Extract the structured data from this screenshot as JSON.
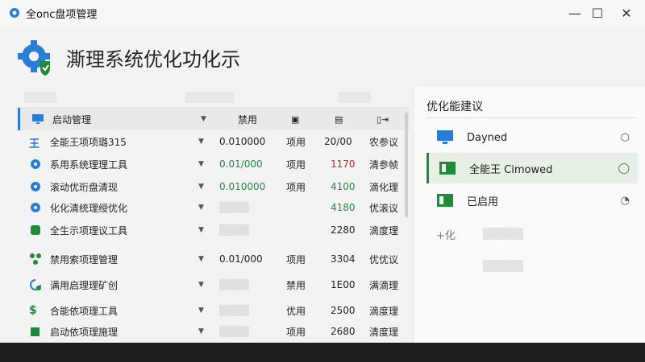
{
  "window": {
    "title": "全onc",
    "title_suffix": "盘项管理",
    "controls": {
      "minimize": "—",
      "maximize": "☐",
      "close": "✕"
    }
  },
  "header": {
    "title": "澌理系统优化功化示"
  },
  "table": {
    "column_headers": {
      "status": "禁用"
    },
    "rows": [
      {
        "name": "启动管理",
        "value": "",
        "c3": "",
        "c4": "",
        "c5": "",
        "icon": "monitor-icon",
        "icon_color": "#2b7cd3",
        "value_color": "#222222",
        "c4_color": "#222222"
      },
      {
        "name": "全能王项项璐315",
        "value": "0.010000",
        "c3": "项用",
        "c4": "20/00",
        "c5": "农参议",
        "icon": "text-icon",
        "icon_color": "#2b7cd3",
        "value_color": "#222222",
        "c4_color": "#222222"
      },
      {
        "name": "系用系统理理工具",
        "value": "0.01/000",
        "c3": "项用",
        "c4": "1170",
        "c5": "清参帧",
        "icon": "gear-icon",
        "icon_color": "#2b7cd3",
        "value_color": "#1f8a3a",
        "c4_color": "#c62828"
      },
      {
        "name": "滚动优珩盘清现",
        "value": "0.010000",
        "c3": "项用",
        "c4": "4100",
        "c5": "滴化理",
        "icon": "gear-icon",
        "icon_color": "#2b7cd3",
        "value_color": "#1f8a3a",
        "c4_color": "#1f8a3a"
      },
      {
        "name": "化化清统理绶优化",
        "value": "",
        "c3": "",
        "c4": "4180",
        "c5": "优滚议",
        "icon": "gear-icon",
        "icon_color": "#2b7cd3",
        "value_color": "#222222",
        "c4_color": "#1f8a3a"
      },
      {
        "name": "全生示项理议工具",
        "value": "",
        "c3": "",
        "c4": "2280",
        "c5": "滴度理",
        "icon": "square-icon",
        "icon_color": "#1f8a3a",
        "value_color": "#222222",
        "c4_color": "#222222"
      },
      {
        "name": "禁用索项理管理",
        "value": "0.01/000",
        "c3": "项用",
        "c4": "3304",
        "c5": "优优议",
        "icon": "network-icon",
        "icon_color": "#1f8a3a",
        "value_color": "#222222",
        "c4_color": "#222222"
      },
      {
        "name": "满用启理理矿创",
        "value": "",
        "c3": "禁用",
        "c4": "1E00",
        "c5": "满滴理",
        "icon": "refresh-icon",
        "icon_color": "#1f8a3a",
        "value_color": "#222222",
        "c4_color": "#222222"
      },
      {
        "name": "合能依项理工具",
        "value": "",
        "c3": "优用",
        "c4": "2500",
        "c5": "滴度理",
        "icon": "dollar-icon",
        "icon_color": "#1f8a3a",
        "value_color": "#222222",
        "c4_color": "#222222"
      },
      {
        "name": "启动依项理施理",
        "value": "",
        "c3": "项用",
        "c4": "2680",
        "c5": "清度理",
        "icon": "puzzle-icon",
        "icon_color": "#1f8a3a",
        "value_color": "#222222",
        "c4_color": "#222222"
      }
    ]
  },
  "suggestions": {
    "title": "优化能建议",
    "items": [
      {
        "label": "Dayned",
        "control": "⬡",
        "icon": "monitor-icon",
        "icon_color": "#2b7cd3",
        "active": false
      },
      {
        "label": "全能王 Cimowed",
        "control": "◯",
        "icon": "window-icon",
        "icon_color": "#1f8a3a",
        "active": true
      },
      {
        "label": "已启用",
        "control": "◔",
        "icon": "window-icon",
        "icon_color": "#1f8a3a",
        "active": false
      }
    ],
    "faded_label": "+化"
  }
}
